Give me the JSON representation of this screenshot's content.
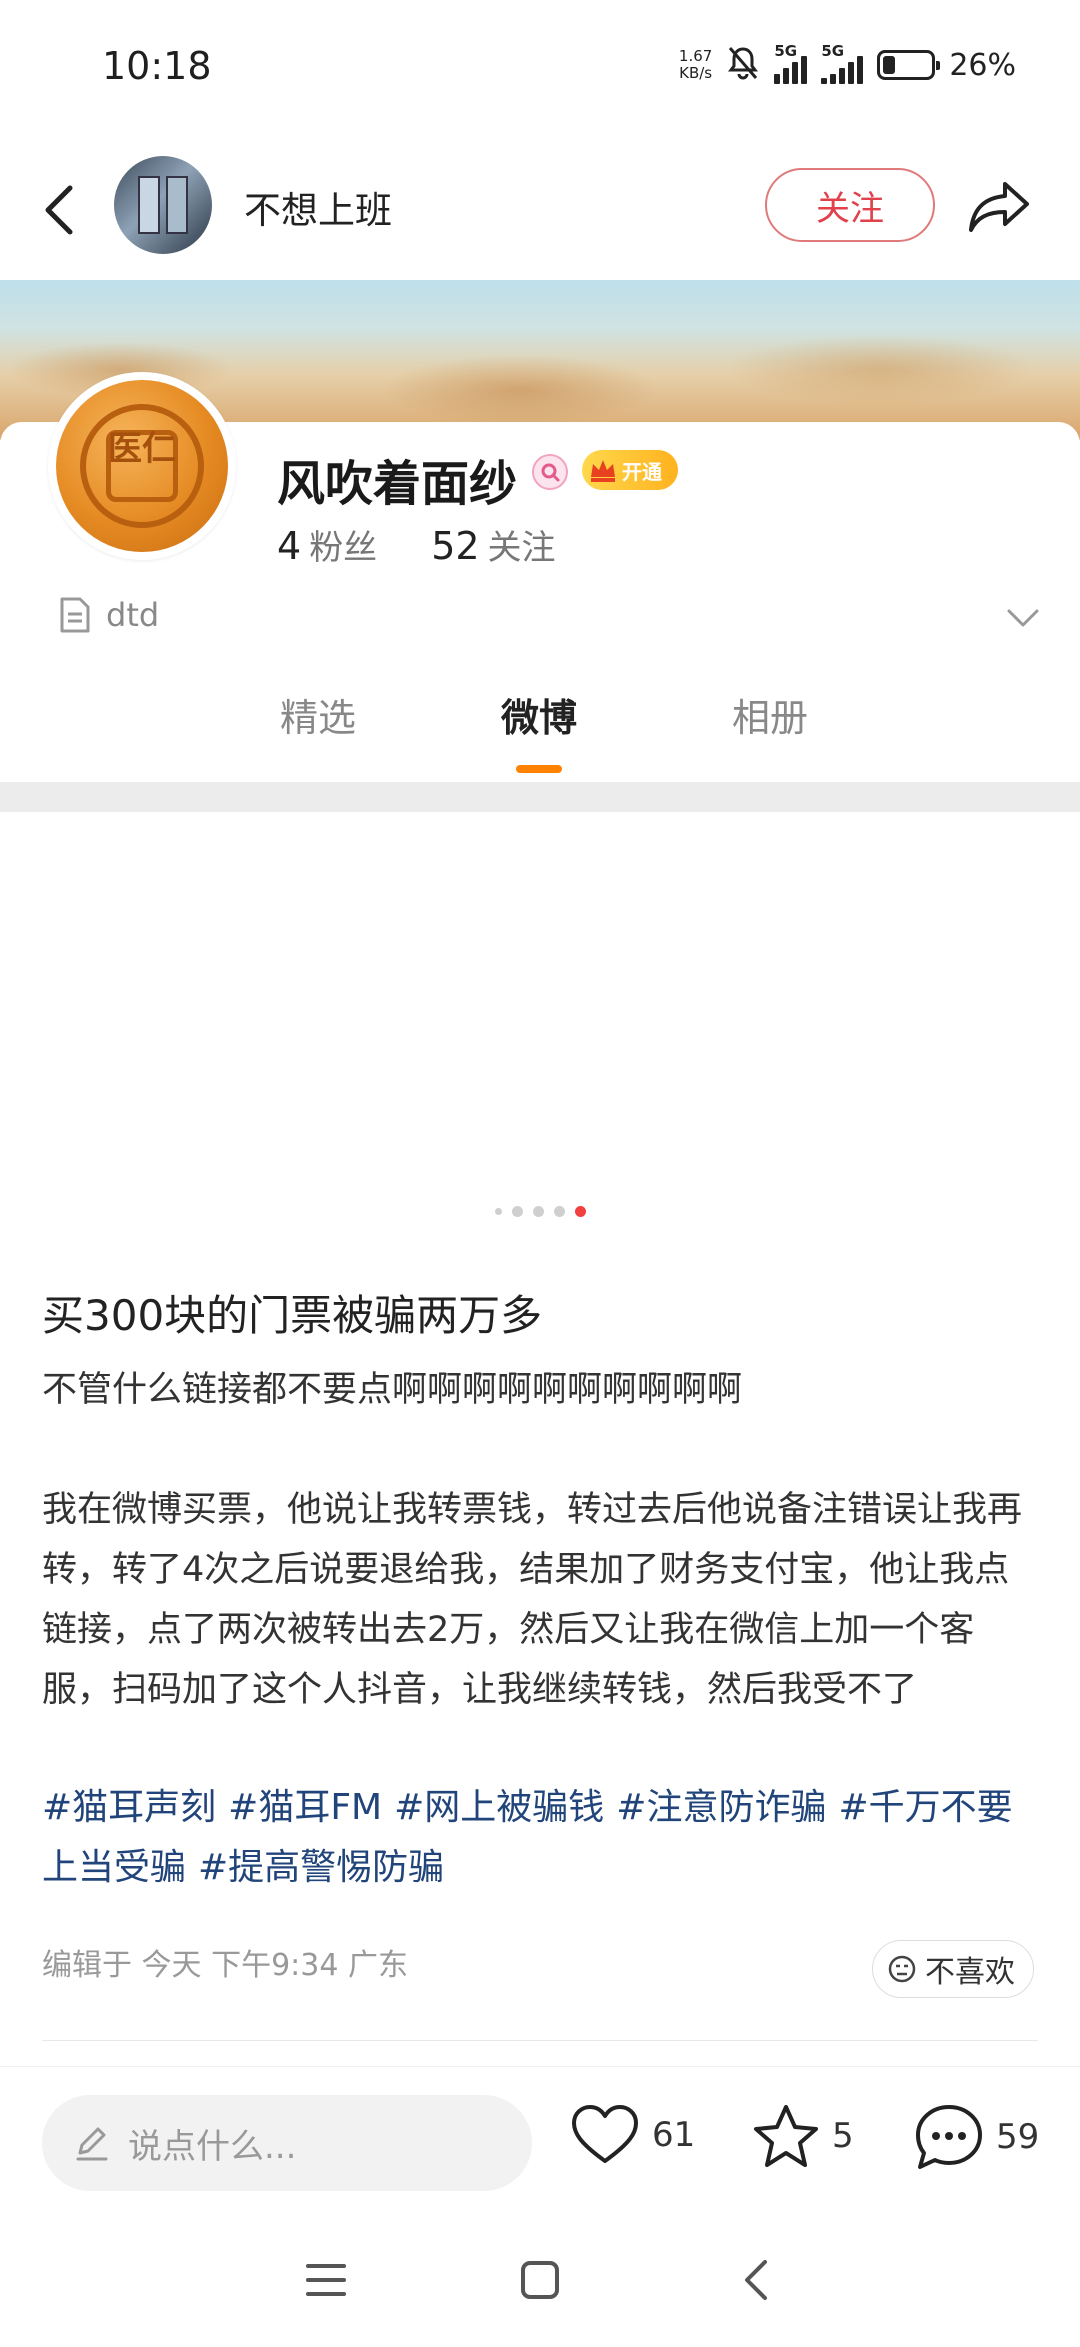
{
  "status_bar": {
    "time": "10:18",
    "net_speed_value": "1.67",
    "net_speed_unit": "KB/s",
    "sim1_label": "5G",
    "sim2_label": "5G",
    "battery_percent": "26%",
    "battery_level": 0.26
  },
  "header": {
    "nav_name": "不想上班",
    "follow_label": "关注"
  },
  "profile": {
    "avatar_text": "医仁",
    "name": "风吹着面纱",
    "vip_label": "开通",
    "fans_count": "4",
    "fans_label": "粉丝",
    "following_count": "52",
    "following_label": "关注",
    "description": "dtd"
  },
  "tabs": [
    {
      "label": "精选",
      "active": false
    },
    {
      "label": "微博",
      "active": true
    },
    {
      "label": "相册",
      "active": false
    }
  ],
  "carousel": {
    "total": 5,
    "active_index": 4
  },
  "post": {
    "title": "买300块的门票被骗两万多",
    "line1": "不管什么链接都不要点啊啊啊啊啊啊啊啊啊啊",
    "paragraph": "我在微博买票，他说让我转票钱，转过去后他说备注错误让我再转，转了4次之后说要退给我，结果加了财务支付宝，他让我点链接，点了两次被转出去2万，然后又让我在微信上加一个客服，扫码加了这个人抖音，让我继续转钱，然后我受不了",
    "tags": [
      "#猫耳声刻",
      "#猫耳FM",
      "#网上被骗钱",
      "#注意防诈骗",
      "#千万不要上当受骗",
      "#提高警惕防骗"
    ],
    "meta": "编辑于  今天  下午9:34  广东",
    "dislike_label": "不喜欢"
  },
  "bottom_bar": {
    "comment_placeholder": "说点什么...",
    "likes": "61",
    "favorites": "5",
    "comments": "59"
  },
  "colors": {
    "accent_orange": "#ff8200",
    "follow_red": "#e0414b",
    "tag_blue": "#21457a",
    "carousel_active": "#f23f3f"
  }
}
